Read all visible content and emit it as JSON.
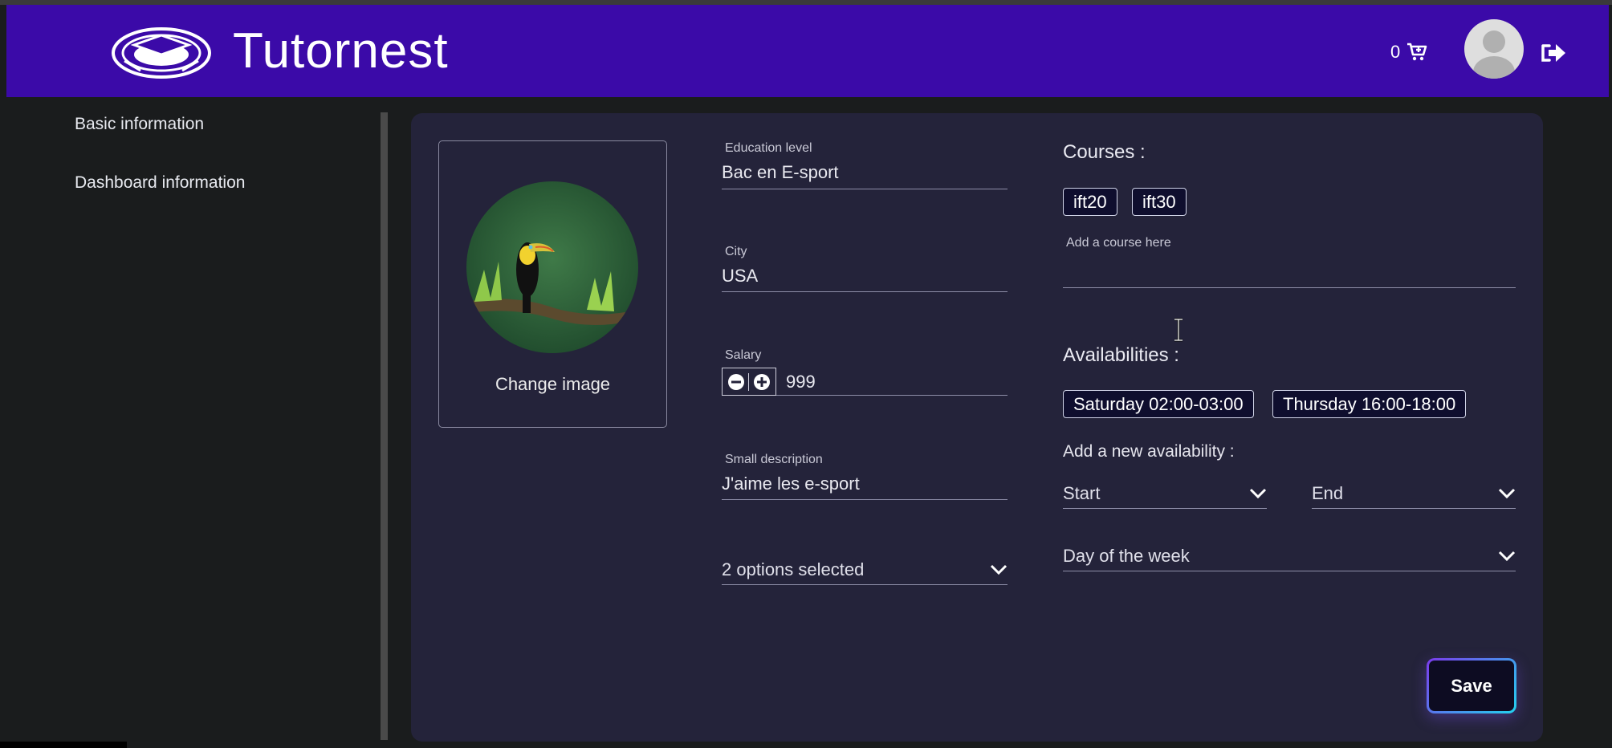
{
  "header": {
    "brand": "Tutornest",
    "cart_count": "0",
    "icons": {
      "logo": "graduation-cap-logo",
      "cart": "cart-icon",
      "avatar": "user-avatar",
      "logout": "sign-out-icon"
    }
  },
  "sidebar": {
    "items": [
      {
        "label": "Basic information"
      },
      {
        "label": "Dashboard information"
      }
    ]
  },
  "profile": {
    "change_image": "Change image"
  },
  "form": {
    "education": {
      "label": "Education level",
      "value": "Bac en E-sport"
    },
    "city": {
      "label": "City",
      "value": "USA"
    },
    "salary": {
      "label": "Salary",
      "value": "999"
    },
    "description": {
      "label": "Small description",
      "value": "J'aime les e-sport"
    },
    "options_select": {
      "value": "2 options selected"
    }
  },
  "courses": {
    "title": "Courses :",
    "items": [
      "ift20",
      "ift30"
    ],
    "input_placeholder": "Add a course here"
  },
  "availabilities": {
    "title": "Availabilities :",
    "items": [
      "Saturday 02:00-03:00",
      "Thursday 16:00-18:00"
    ],
    "add_title": "Add a new availability :",
    "start_label": "Start",
    "end_label": "End",
    "day_label": "Day of the week"
  },
  "actions": {
    "save": "Save"
  },
  "colors": {
    "header_bg": "#3b0aa8",
    "panel_bg": "#24233a",
    "page_bg": "#1a1c1d"
  }
}
